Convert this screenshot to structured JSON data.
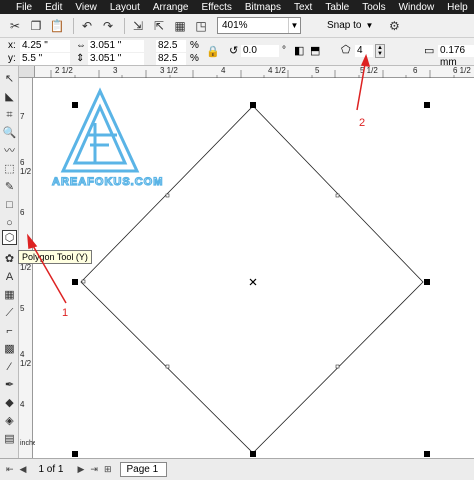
{
  "menu": [
    "File",
    "Edit",
    "View",
    "Layout",
    "Arrange",
    "Effects",
    "Bitmaps",
    "Text",
    "Table",
    "Tools",
    "Window",
    "Help"
  ],
  "toolbar": {
    "zoom": "401%",
    "snap_label": "Snap to"
  },
  "propbar": {
    "x_label": "x:",
    "x_value": "4.25 \"",
    "y_label": "y:",
    "y_value": "5.5 \"",
    "width_value": "3.051 \"",
    "height_value": "3.051 \"",
    "scale_x": "82.5",
    "scale_y": "82.5",
    "pct_x": "%",
    "pct_y": "%",
    "rotation": "0.0",
    "sides": "4",
    "outline": "0.176 mm"
  },
  "ruler": {
    "h_labels": [
      "2 1/2",
      "3",
      "3 1/2",
      "4",
      "4 1/2",
      "5",
      "5 1/2",
      "6",
      "6 1/2"
    ],
    "v_labels": [
      "7",
      "6 1/2",
      "6",
      "5 1/2",
      "5",
      "4 1/2",
      "4"
    ],
    "unit": "inches"
  },
  "tooltip": "Polygon Tool (Y)",
  "watermark": "AREAFOKUS.COM",
  "annotations": [
    "1",
    "2"
  ],
  "status": {
    "page_count": "1 of 1",
    "page_tab": "Page 1"
  },
  "colors": {
    "menubar": "#1f1f1f",
    "annotation": "#dd2222",
    "logo": "#5ab4e6"
  }
}
